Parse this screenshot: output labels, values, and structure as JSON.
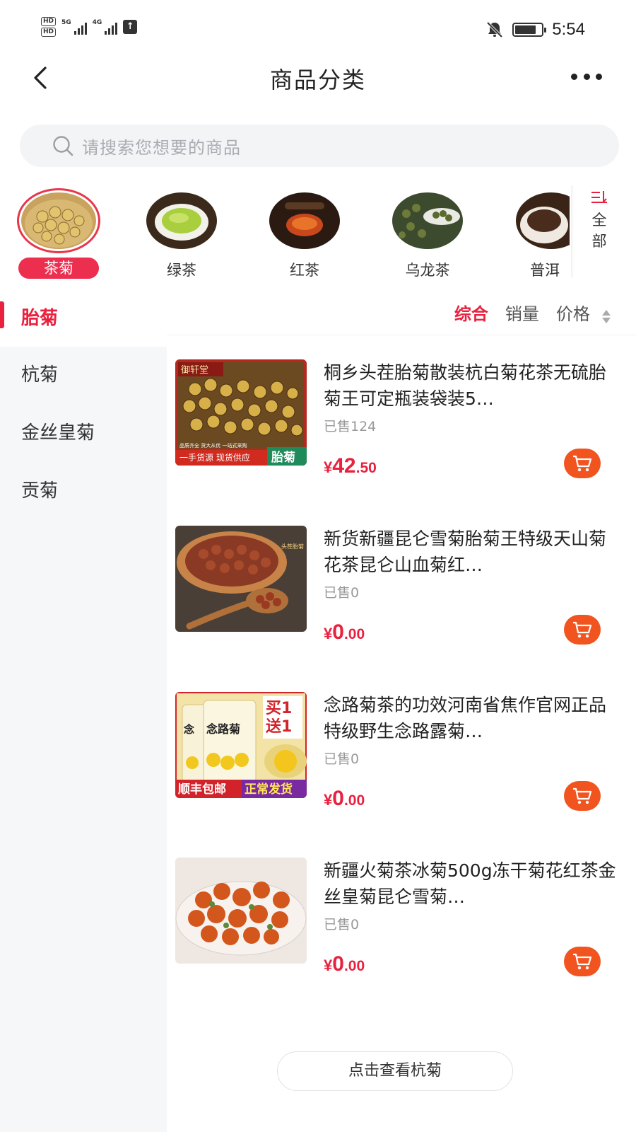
{
  "status_bar": {
    "left": {
      "hd1": "HD",
      "hd2": "HD",
      "net1": "5G",
      "net2": "4G"
    },
    "time": "5:54",
    "battery_level": 0.8
  },
  "nav": {
    "title": "商品分类"
  },
  "search": {
    "placeholder": "请搜索您想要的商品"
  },
  "categories": [
    {
      "label": "茶菊",
      "active": true
    },
    {
      "label": "绿茶"
    },
    {
      "label": "红茶"
    },
    {
      "label": "乌龙茶"
    },
    {
      "label": "普洱"
    }
  ],
  "all_button": {
    "label": "全部"
  },
  "sidebar": [
    {
      "label": "胎菊",
      "active": true
    },
    {
      "label": "杭菊"
    },
    {
      "label": "金丝皇菊"
    },
    {
      "label": "贡菊"
    }
  ],
  "sort": {
    "options": [
      "综合",
      "销量",
      "价格"
    ],
    "active": "综合"
  },
  "products": [
    {
      "title": "桐乡头茬胎菊散装杭白菊花茶无硫胎菊王可定瓶装袋装5…",
      "sold": "已售124",
      "price": {
        "currency": "¥",
        "integer": "42",
        "decimal": ".50"
      },
      "image_text": {
        "brand": "御轩堂",
        "banner": "一手货源 现货供应",
        "tag": "胎菊",
        "small": "品质齐全 货大从优 一站式采购"
      }
    },
    {
      "title": "新货新疆昆仑雪菊胎菊王特级天山菊花茶昆仑山血菊红…",
      "sold": "已售0",
      "price": {
        "currency": "¥",
        "integer": "0",
        "decimal": ".00"
      },
      "image_text": {
        "tag": "头茬胎菊"
      }
    },
    {
      "title": "念路菊茶的功效河南省焦作官网正品特级野生念路露菊…",
      "sold": "已售0",
      "price": {
        "currency": "¥",
        "integer": "0",
        "decimal": ".00"
      },
      "image_text": {
        "big1": "买1",
        "big2": "送1",
        "name": "念路菊",
        "left_label": "顺丰包邮",
        "right_label": "正常发货"
      }
    },
    {
      "title": "新疆火菊茶冰菊500g冻干菊花红茶金丝皇菊昆仑雪菊…",
      "sold": "已售0",
      "price": {
        "currency": "¥",
        "integer": "0",
        "decimal": ".00"
      }
    }
  ],
  "footer": {
    "more_button": "点击查看杭菊"
  },
  "colors": {
    "accent": "#e9213f",
    "cart": "#f1541f",
    "sidebar_bg": "#f6f7f9",
    "search_bg": "#f3f4f6"
  }
}
